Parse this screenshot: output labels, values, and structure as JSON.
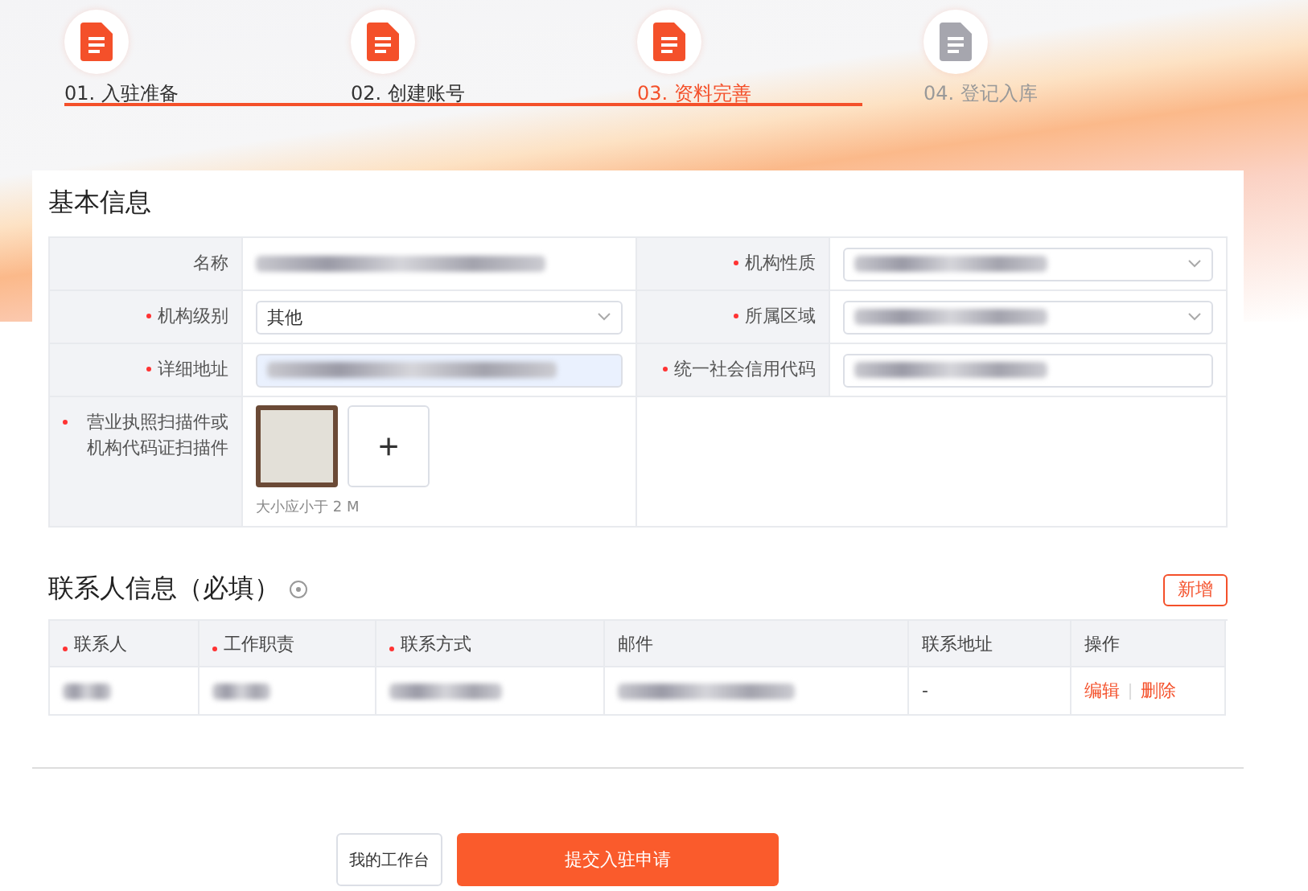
{
  "steps": [
    {
      "label": "01. 入驻准备",
      "completed": true,
      "selected": false
    },
    {
      "label": "02. 创建账号",
      "completed": true,
      "selected": false
    },
    {
      "label": "03. 资料完善",
      "completed": false,
      "selected": true
    },
    {
      "label": "04. 登记入库",
      "completed": false,
      "selected": false
    }
  ],
  "basic_info": {
    "title": "基本信息",
    "fields": [
      {
        "label": "名称",
        "required": false,
        "kind": "text"
      },
      {
        "label": "机构性质",
        "required": true,
        "kind": "select"
      },
      {
        "label": "机构级别",
        "required": true,
        "kind": "select",
        "value": "其他"
      },
      {
        "label": "所属区域",
        "required": true,
        "kind": "select"
      },
      {
        "label": "详细地址",
        "required": true,
        "kind": "input",
        "focused": true
      },
      {
        "label": "统一社会信用代码",
        "required": true,
        "kind": "input",
        "focused": false
      }
    ],
    "upload": {
      "label": "营业执照扫描件或机构代码证扫描件",
      "required": true,
      "add": "+",
      "hint": "大小应小于 2 M"
    }
  },
  "contacts": {
    "title": "联系人信息（必填）",
    "add_button": "新增",
    "columns": [
      {
        "label": "联系人",
        "required": true
      },
      {
        "label": "工作职责",
        "required": true
      },
      {
        "label": "联系方式",
        "required": true
      },
      {
        "label": "邮件",
        "required": false
      },
      {
        "label": "联系地址",
        "required": false
      },
      {
        "label": "操作",
        "required": false
      }
    ],
    "rows": [
      {
        "address": "-",
        "actions": [
          "编辑",
          "删除"
        ]
      }
    ]
  },
  "buttons": {
    "secondary": "我的工作台",
    "primary": "提交入驻申请"
  }
}
